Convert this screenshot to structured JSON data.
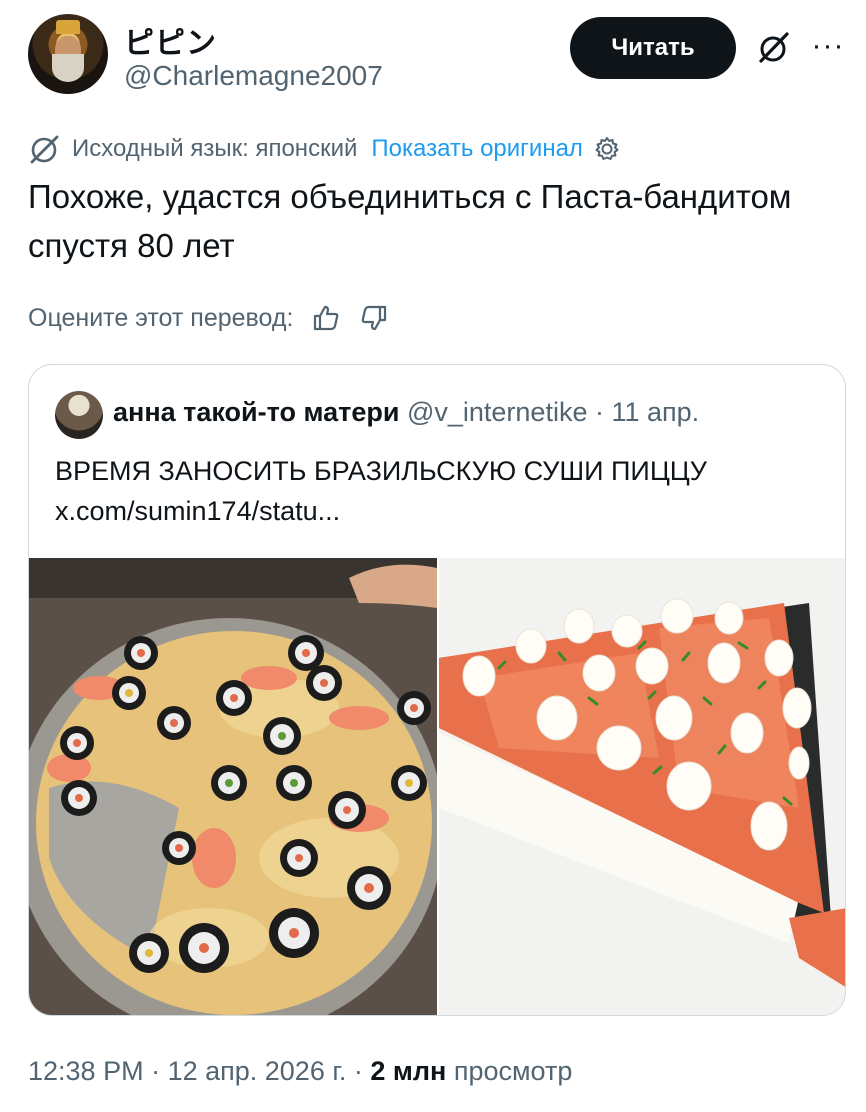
{
  "author": {
    "display_name": "ピピン",
    "handle": "@Charlemagne2007"
  },
  "actions": {
    "follow_label": "Читать",
    "grok_icon": "grok-icon",
    "more_icon": "more-icon",
    "more_glyph": "···"
  },
  "translation": {
    "source_language": "Исходный язык: японский",
    "show_original": "Показать оригинал",
    "text": "Похоже, удастся объединиться с Паста-бандитом спустя 80 лет",
    "rate_label": "Оцените этот перевод:"
  },
  "quote": {
    "name": "анна такой-то матери",
    "handle": "@v_internetike",
    "separator": "·",
    "date": "11 апр.",
    "text_line1": "ВРЕМЯ ЗАНОСИТЬ БРАЗИЛЬСКУЮ СУШИ ПИЦЦУ",
    "text_line2": "x.com/sumin174/statu..."
  },
  "meta": {
    "time": "12:38 PM",
    "sep1": " · ",
    "date": "12 апр. 2026 г.",
    "sep2": " · ",
    "views_count": "2 млн",
    "views_label": " просмотр"
  },
  "colors": {
    "accent": "#1d9bf0",
    "muted": "#536471",
    "text": "#0f1419",
    "border": "#cfd9de"
  }
}
